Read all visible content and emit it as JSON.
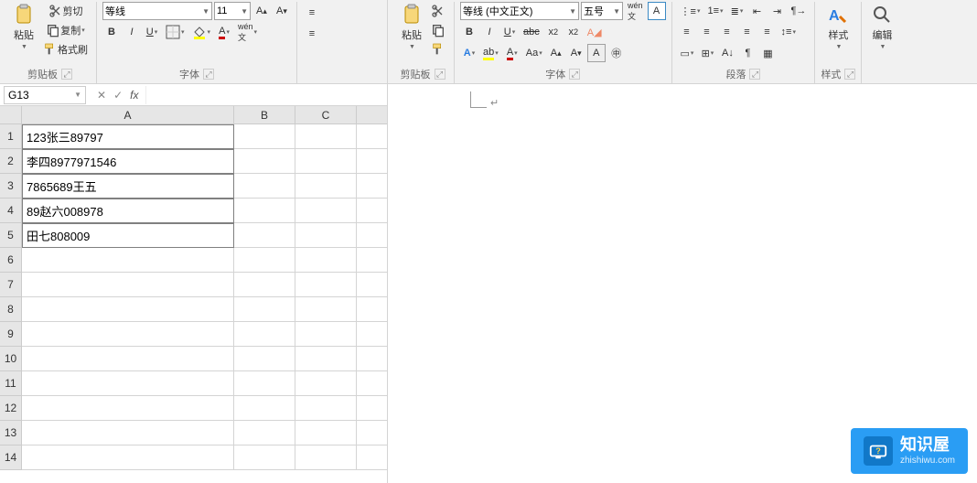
{
  "excel": {
    "clipboard": {
      "paste": "粘贴",
      "cut": "剪切",
      "copy": "复制",
      "format_painter": "格式刷",
      "label": "剪贴板"
    },
    "font": {
      "name": "等线",
      "size": "11",
      "label": "字体"
    },
    "namebox": "G13",
    "columns": [
      "A",
      "B",
      "C"
    ],
    "rows": [
      "1",
      "2",
      "3",
      "4",
      "5",
      "6",
      "7",
      "8",
      "9",
      "10",
      "11",
      "12",
      "13",
      "14"
    ],
    "cells": {
      "A1": "123张三89797",
      "A2": "李四8977971546",
      "A3": "7865689王五",
      "A4": "89赵六008978",
      "A5": "田七808009"
    }
  },
  "word": {
    "clipboard": {
      "paste": "粘贴",
      "label": "剪贴板"
    },
    "font": {
      "name": "等线 (中文正文)",
      "size": "五号",
      "ruby": "wén",
      "label": "字体"
    },
    "paragraph": {
      "label": "段落"
    },
    "styles": {
      "label": "样式"
    },
    "editing": {
      "label": "编辑"
    }
  },
  "watermark": {
    "title": "知识屋",
    "url": "zhishiwu.com"
  }
}
